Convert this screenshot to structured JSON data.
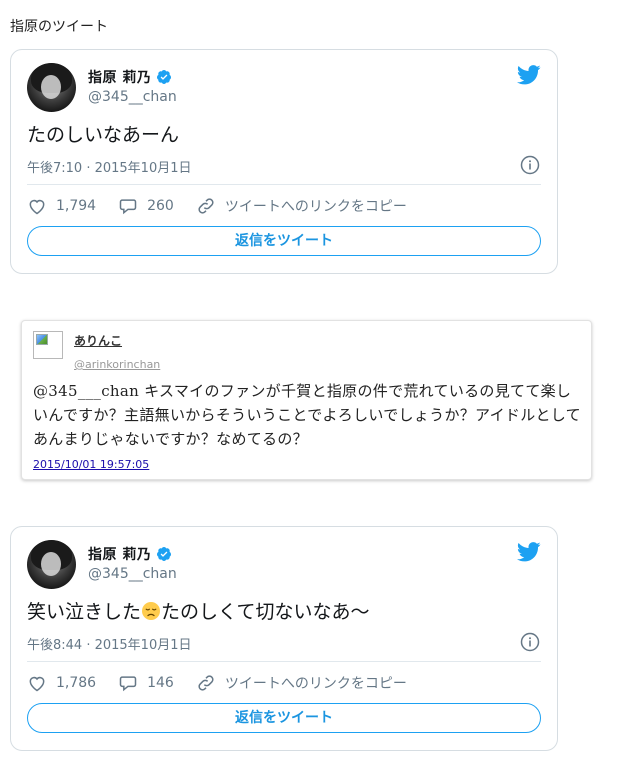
{
  "section": {
    "title": "指原のツイート"
  },
  "tweets": [
    {
      "display_name": "指原 莉乃",
      "handle": "@345__chan",
      "text": "たのしいなあーん",
      "emoji": "",
      "text_after_emoji": "",
      "timestamp": "午後7:10 · 2015年10月1日",
      "likes": "1,794",
      "replies": "260",
      "copy_link_label": "ツイートへのリンクをコピー",
      "reply_button_label": "返信をツイート"
    },
    {
      "display_name": "指原 莉乃",
      "handle": "@345__chan",
      "text": "笑い泣きした",
      "emoji": "disappointed-face",
      "text_after_emoji": "たのしくて切ないなあ〜",
      "timestamp": "午後8:44 · 2015年10月1日",
      "likes": "1,786",
      "replies": "146",
      "copy_link_label": "ツイートへのリンクをコピー",
      "reply_button_label": "返信をツイート"
    }
  ],
  "embed": {
    "author": "ありんこ",
    "handle": "@arinkorinchan",
    "text": "@345___chan キスマイのファンが千賀と指原の件で荒れているの見てて楽しいんですか？主語無いからそういうことでよろしいでしょうか？アイドルとしてあんまりじゃないですか？なめてるの？",
    "date": "2015/10/01 19:57:05"
  },
  "colors": {
    "twitter_blue": "#1da1f2",
    "verified_blue": "#1da1f2",
    "secondary_text": "#657786",
    "border": "#d6dde2"
  },
  "icons": [
    "twitter-logo-icon",
    "verified-badge-icon",
    "info-icon",
    "heart-icon",
    "reply-bubble-icon",
    "link-icon",
    "broken-image-icon",
    "disappointed-face-emoji"
  ]
}
